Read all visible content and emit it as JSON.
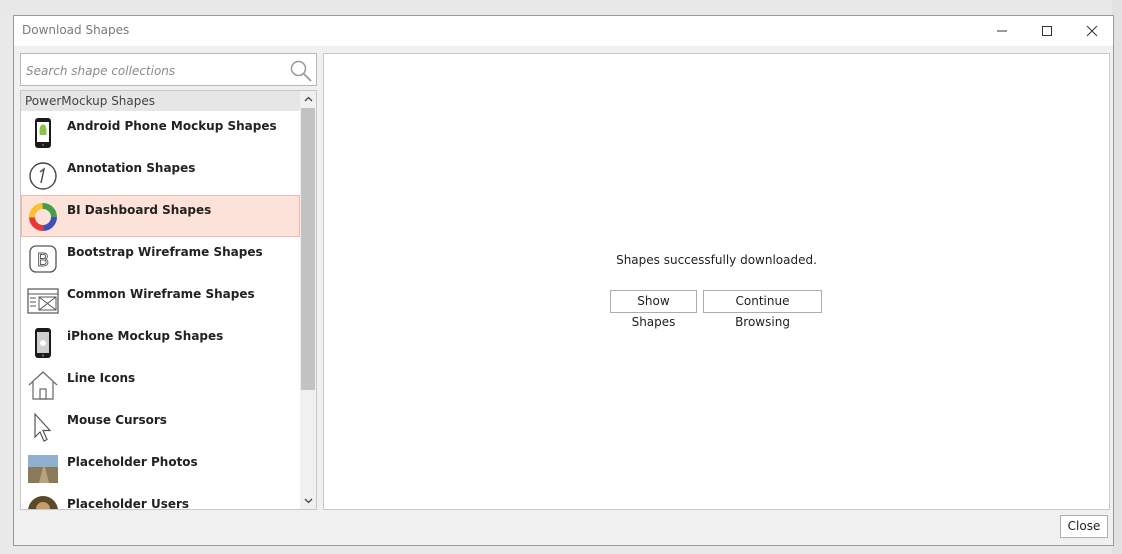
{
  "window": {
    "title": "Download Shapes",
    "controls": {
      "minimize": "minimize",
      "maximize": "maximize",
      "close": "close"
    }
  },
  "search": {
    "placeholder": "Search shape collections",
    "value": ""
  },
  "list": {
    "group": "PowerMockup Shapes",
    "items": [
      {
        "label": "Android Phone Mockup Shapes",
        "icon": "android-phone-icon"
      },
      {
        "label": "Annotation Shapes",
        "icon": "annotation-icon"
      },
      {
        "label": "BI Dashboard Shapes",
        "icon": "donut-chart-icon",
        "selected": true
      },
      {
        "label": "Bootstrap Wireframe Shapes",
        "icon": "bootstrap-icon"
      },
      {
        "label": "Common Wireframe Shapes",
        "icon": "wireframe-icon"
      },
      {
        "label": "iPhone Mockup Shapes",
        "icon": "iphone-icon"
      },
      {
        "label": "Line Icons",
        "icon": "house-icon"
      },
      {
        "label": "Mouse Cursors",
        "icon": "cursor-icon"
      },
      {
        "label": "Placeholder Photos",
        "icon": "photo-icon"
      },
      {
        "label": "Placeholder Users",
        "icon": "user-photo-icon"
      }
    ]
  },
  "content": {
    "status": "Shapes successfully downloaded.",
    "show_button": "Show Shapes",
    "continue_button": "Continue Browsing"
  },
  "footer": {
    "close_button": "Close"
  }
}
